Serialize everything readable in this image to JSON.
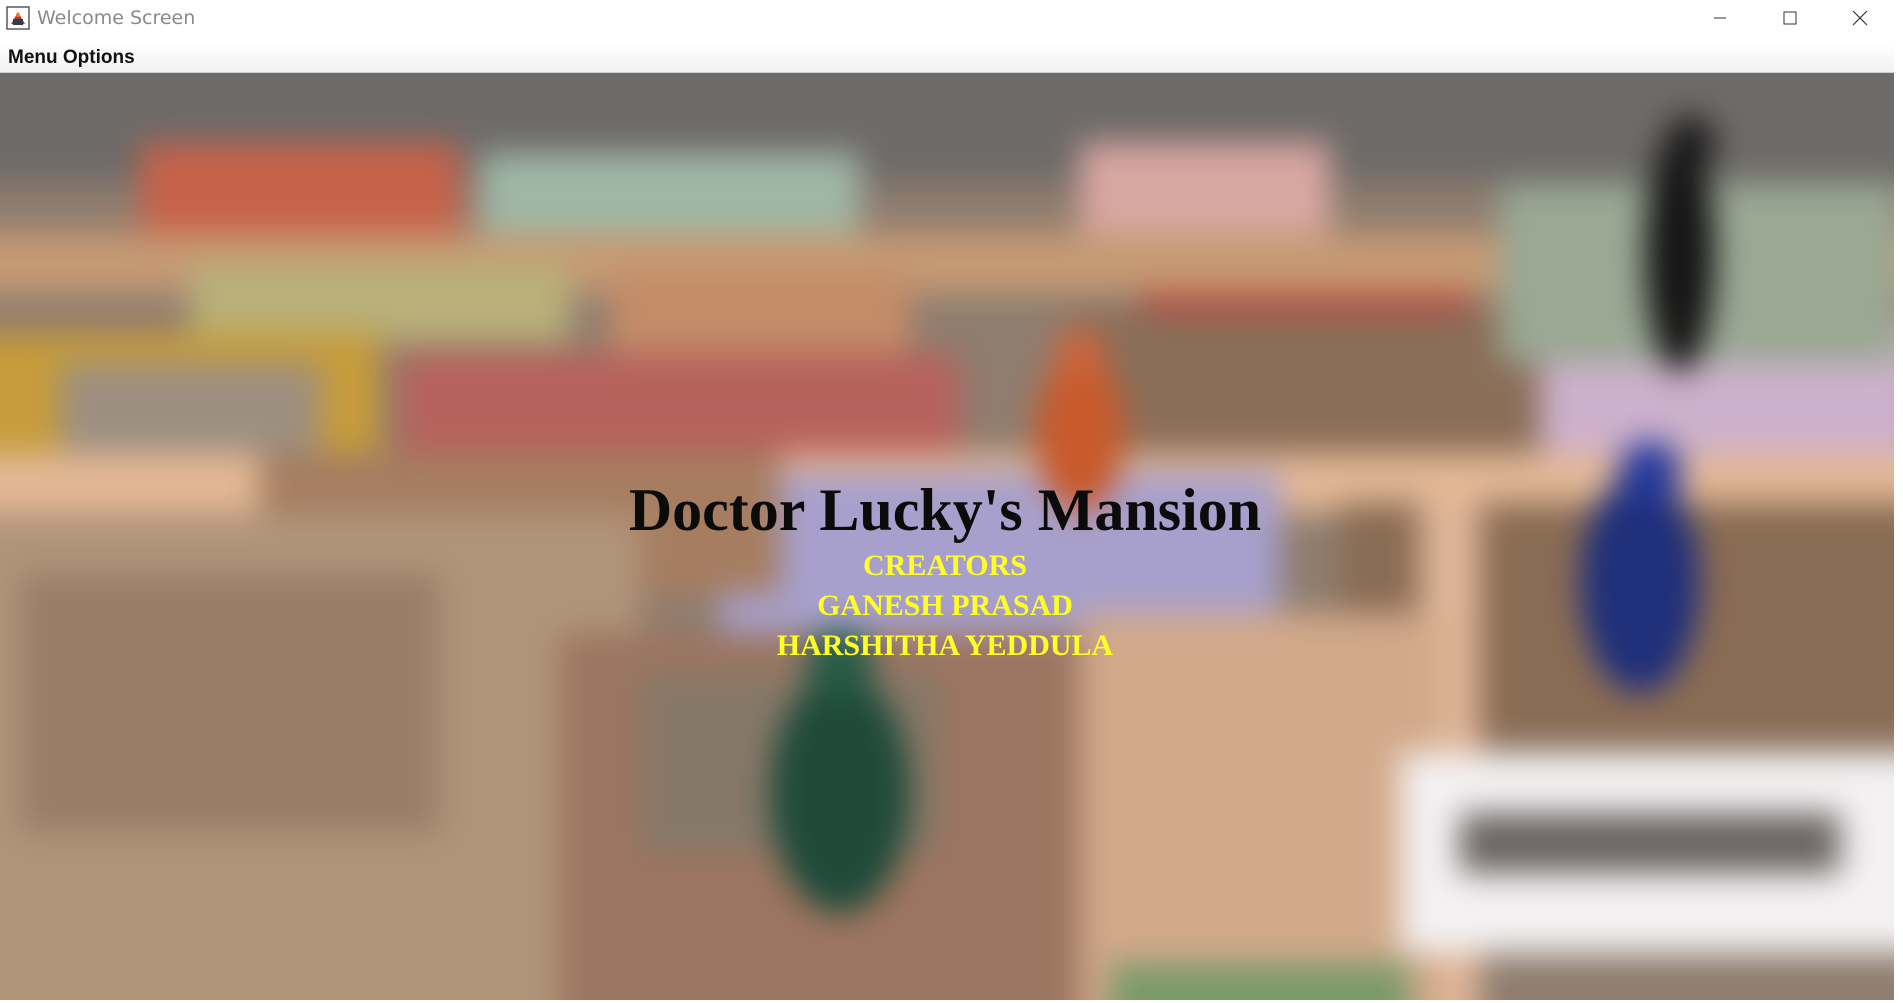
{
  "window": {
    "title": "Welcome Screen",
    "controls": [
      "minimize-icon",
      "maximize-icon",
      "close-icon"
    ]
  },
  "menu_bar": {
    "items": [
      {
        "label": "Menu Options"
      }
    ]
  },
  "welcome": {
    "title": "Doctor Lucky's Mansion",
    "credits_heading": "CREATORS",
    "creators": [
      "GANESH PRASAD",
      "HARSHITHA YEDDULA"
    ]
  },
  "colors": {
    "title_text": "#0b0b0b",
    "credit_text": "#ffff26",
    "background_blur": "board-game photo"
  },
  "icons": {
    "app": "java-app-icon",
    "pieces": [
      "orange-pawn",
      "blue-pawn",
      "green-pawn",
      "black-pawn"
    ]
  }
}
